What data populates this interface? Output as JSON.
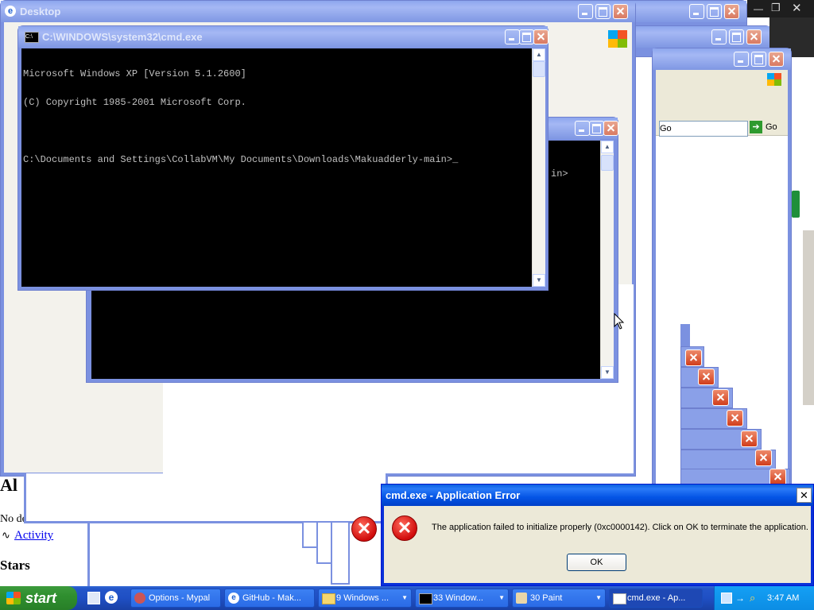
{
  "desktop_window": {
    "title": "Desktop"
  },
  "cmd_front": {
    "title": "C:\\WINDOWS\\system32\\cmd.exe",
    "lines": [
      "Microsoft Windows XP [Version 5.1.2600]",
      "(C) Copyright 1985-2001 Microsoft Corp.",
      "",
      "C:\\Documents and Settings\\CollabVM\\My Documents\\Downloads\\Makuadderly-main>_"
    ]
  },
  "cmd_back": {
    "visible_text": "in>"
  },
  "browser_back": {
    "go_label": "Go"
  },
  "page_behind": {
    "heading_fragment": "Al",
    "desc_fragment": "No des",
    "activity_link": "Activity",
    "stars_heading": "Stars"
  },
  "error_dialog": {
    "title": "cmd.exe - Application Error",
    "message": "The application failed to initialize properly (0xc0000142). Click on OK to terminate the application.",
    "ok_label": "OK"
  },
  "taskbar": {
    "start_label": "start",
    "items": [
      {
        "label": "Options - Mypal",
        "icon": "mypal-icon"
      },
      {
        "label": "GitHub - Mak...",
        "icon": "ie-icon"
      },
      {
        "label": "9 Windows ...",
        "icon": "folder-icon",
        "count": "9"
      },
      {
        "label": "33 Window...",
        "icon": "cmd-icon",
        "count": "33"
      },
      {
        "label": "30 Paint",
        "icon": "paint-icon",
        "count": "30"
      },
      {
        "label": "cmd.exe - Ap...",
        "icon": "dialog-icon"
      }
    ],
    "clock": "3:47 AM"
  },
  "colors": {
    "xp_blue": "#0831d9",
    "start_green": "#2f8f2f",
    "console_bg": "#000000",
    "console_fg": "#c0c0c0",
    "dialog_bg": "#ece9d8"
  }
}
